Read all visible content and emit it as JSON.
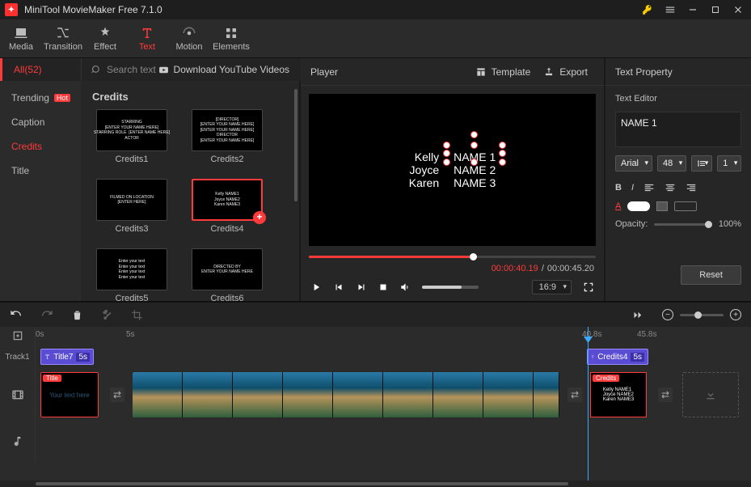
{
  "titlebar": {
    "app_name": "MiniTool MovieMaker Free 7.1.0"
  },
  "mediabar": {
    "media": "Media",
    "transition": "Transition",
    "effect": "Effect",
    "text": "Text",
    "motion": "Motion",
    "elements": "Elements"
  },
  "row2": {
    "all": "All(52)",
    "search_placeholder": "Search text",
    "youtube": "Download YouTube Videos"
  },
  "categories": {
    "trending": "Trending",
    "hot": "Hot",
    "caption": "Caption",
    "credits": "Credits",
    "title": "Title"
  },
  "section_title": "Credits",
  "thumbs": {
    "c1": "Credits1",
    "c2": "Credits2",
    "c3": "Credits3",
    "c4": "Credits4",
    "c5": "Credits5",
    "c6": "Credits6"
  },
  "thumb_text": {
    "c1": "STARRING\n[ENTER YOUR NAME HERE]\nSTARRING ROLE  [ENTER NAME HERE]\nACTOR",
    "c2": "[DIRECTOR]\n[ENTER YOUR NAME HERE]\n[ENTER YOUR NAME HERE]\nDIRECTOR\n[ENTER YOUR NAME HERE]",
    "c3": "FILMED ON LOCATION\n[ENTER HERE]",
    "c4": "Kelly NAME1\nJoyce NAME2\nKaren NAME3",
    "c5": "Enter your text\nEnter your text\nEnter your text\nEnter your text",
    "c6": "DIRECTED BY\nENTER YOUR NAME HERE"
  },
  "player": {
    "label": "Player",
    "template": "Template",
    "export": "Export",
    "cur": "00:00:40.19",
    "dur": "00:00:45.20",
    "aspect": "16:9"
  },
  "preview": {
    "left": [
      "Kelly",
      "Joyce",
      "Karen"
    ],
    "right": [
      "NAME 1",
      "NAME 2",
      "NAME 3"
    ]
  },
  "rprops": {
    "title": "Text Property",
    "section": "Text Editor",
    "value": "NAME 1",
    "font": "Arial",
    "size": "48",
    "lineheight": "1",
    "opacity_label": "Opacity:",
    "opacity_value": "100%",
    "reset": "Reset"
  },
  "timeline": {
    "ruler": {
      "t0": "0s",
      "t1": "5s",
      "t2": "40.8s",
      "t3": "45.8s"
    },
    "track1": "Track1",
    "clip1": {
      "name": "Title7",
      "dur": "5s"
    },
    "clip2": {
      "name": "Credits4",
      "dur": "5s"
    },
    "titleclip": {
      "tag": "Title",
      "text": "Your text here"
    },
    "creditsclip": {
      "tag": "Credits",
      "text": "Kelly NAME1\nJoyce NAME2\nKaren NAME3"
    }
  }
}
